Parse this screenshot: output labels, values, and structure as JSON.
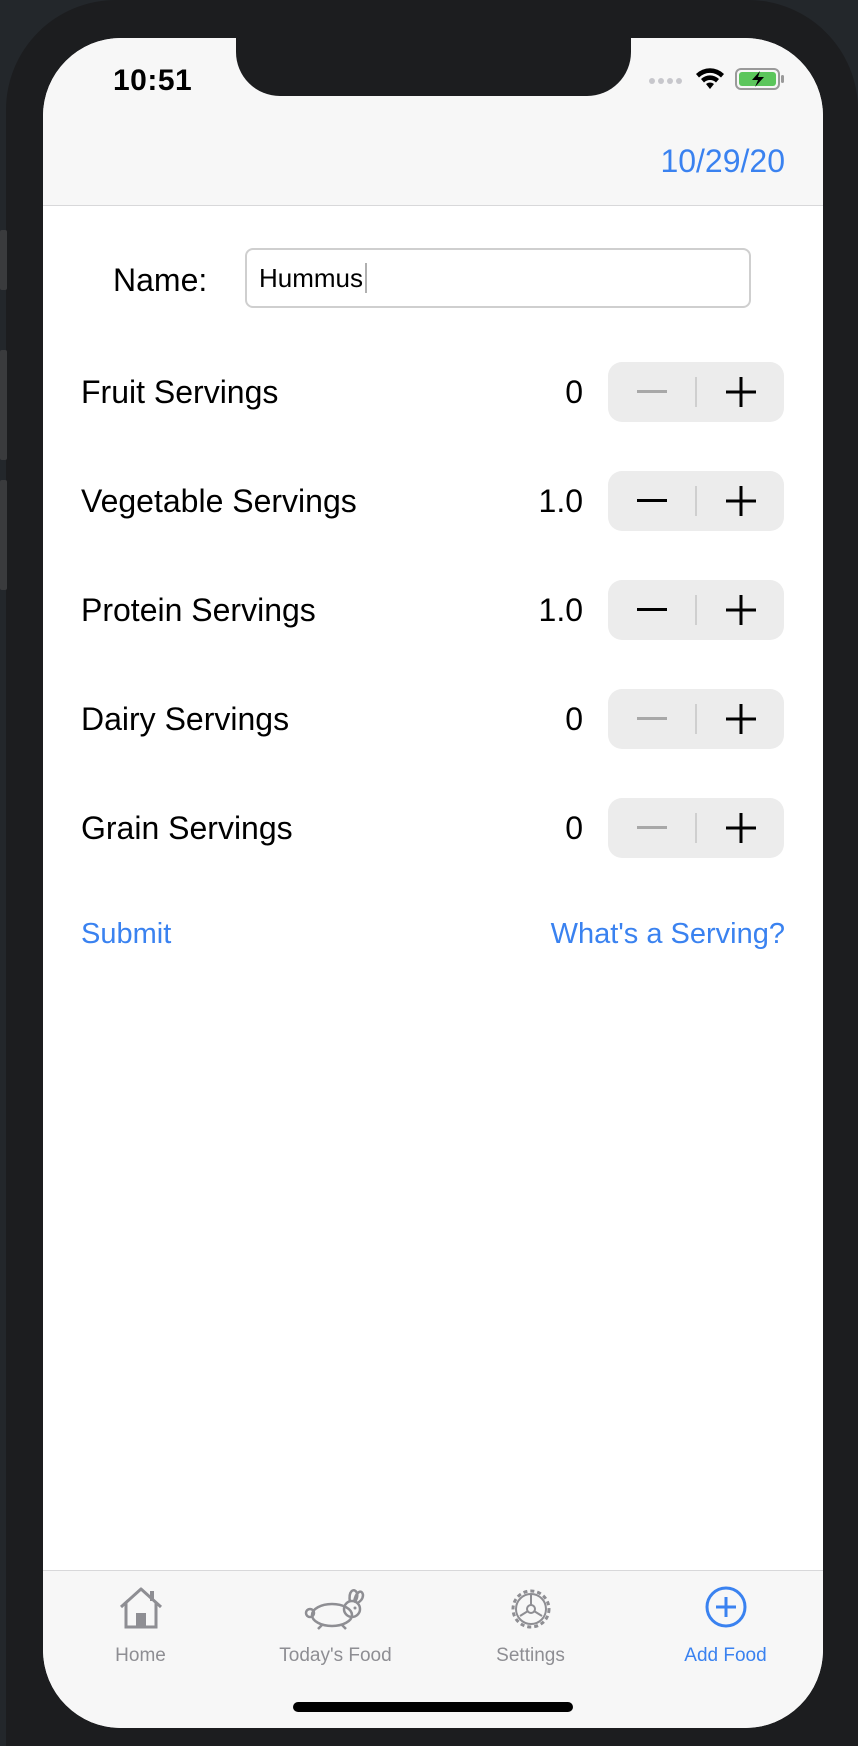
{
  "status_bar": {
    "time": "10:51"
  },
  "nav": {
    "date": "10/29/20"
  },
  "form": {
    "name_label": "Name:",
    "name_value": "Hummus",
    "rows": [
      {
        "label": "Fruit Servings",
        "value": "0"
      },
      {
        "label": "Vegetable Servings",
        "value": "1.0"
      },
      {
        "label": "Protein Servings",
        "value": "1.0"
      },
      {
        "label": "Dairy Servings",
        "value": "0"
      },
      {
        "label": "Grain Servings",
        "value": "0"
      }
    ]
  },
  "actions": {
    "submit": "Submit",
    "help": "What's a Serving?"
  },
  "tabs": [
    {
      "label": "Home",
      "icon": "house-icon"
    },
    {
      "label": "Today's Food",
      "icon": "rabbit-icon"
    },
    {
      "label": "Settings",
      "icon": "gear-icon"
    },
    {
      "label": "Add Food",
      "icon": "plus-circle-icon"
    }
  ],
  "colors": {
    "accent": "#3a82f0",
    "tab_inactive": "#8e8e93"
  }
}
